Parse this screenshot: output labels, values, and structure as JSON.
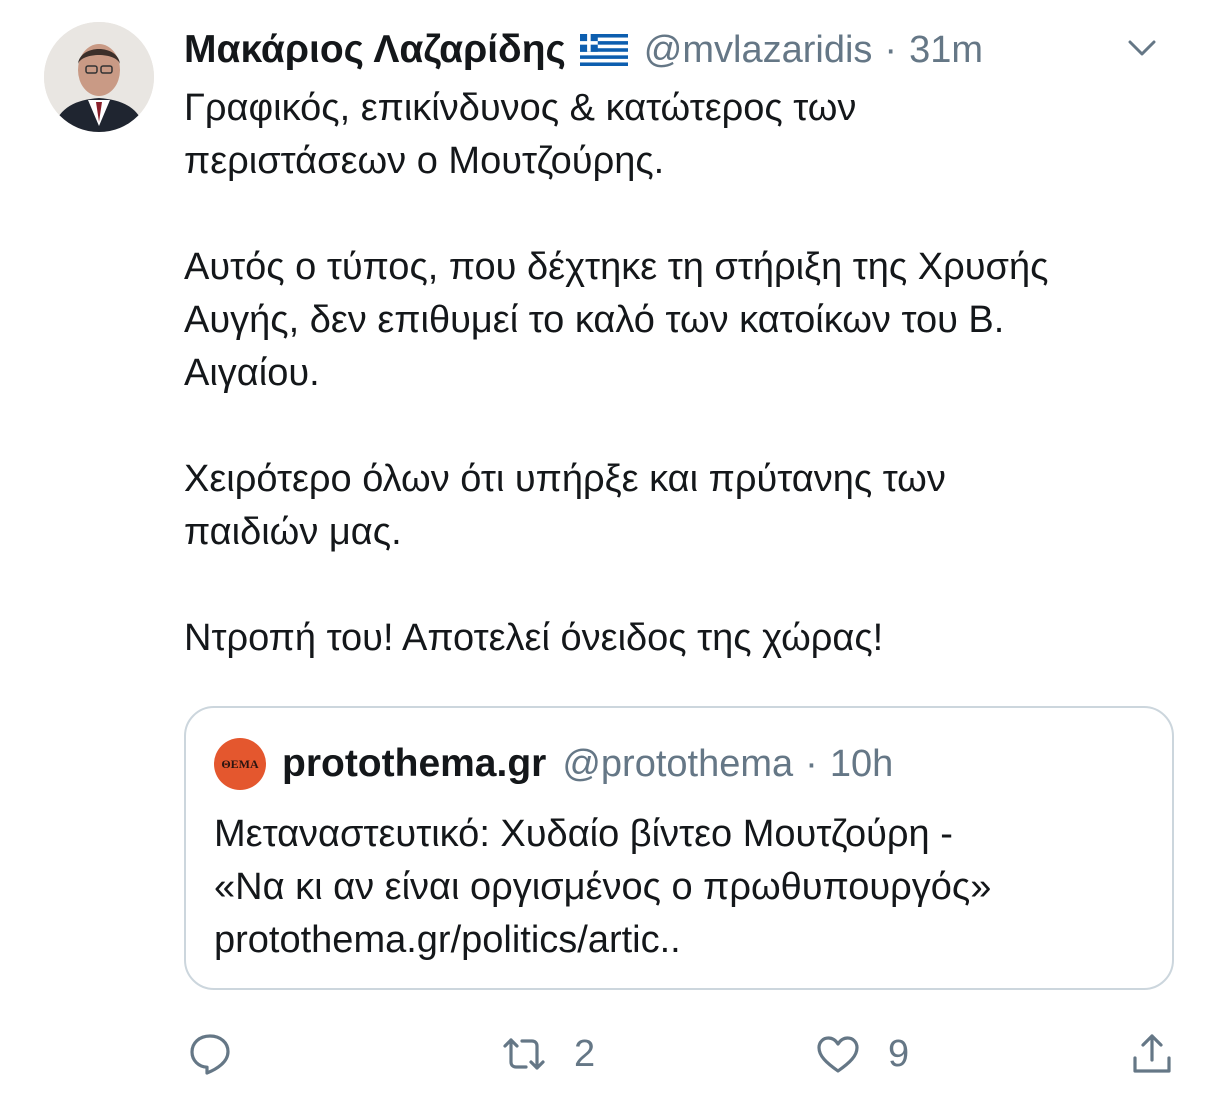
{
  "author": {
    "name": "Μακάριος Λαζαρίδης",
    "flag_icon": "greek-flag-icon",
    "handle": "@mvlazaridis",
    "separator": "·",
    "time": "31m"
  },
  "tweet": {
    "paragraphs": [
      [
        "Γραφικός, επικίνδυνος & κατώτερος των",
        "περιστάσεων ο Μουτζούρης."
      ],
      [
        "Αυτός ο τύπος, που δέχτηκε τη στήριξη της Χρυσής",
        "Αυγής, δεν επιθυμεί το καλό των κατοίκων του Β.",
        "Αιγαίου."
      ],
      [
        "Χειρότερο όλων ότι υπήρξε και πρύτανης των",
        "παιδιών μας."
      ],
      [
        "Ντροπή του! Αποτελεί όνειδος της χώρας!"
      ]
    ]
  },
  "quote": {
    "logo_text": "ΘΕΜΑ",
    "name": "protothema.gr",
    "handle": "@protothema",
    "separator": "·",
    "time": "10h",
    "lines": [
      "Μεταναστευτικό: Χυδαίο βίντεο Μουτζούρη -",
      "«Να κι αν είναι οργισμένος ο πρωθυπουργός»",
      "protothema.gr/politics/artic.."
    ]
  },
  "actions": {
    "reply_icon": "reply-icon",
    "retweet_icon": "retweet-icon",
    "retweet_count": "2",
    "like_icon": "heart-icon",
    "like_count": "9",
    "share_icon": "share-icon"
  },
  "colors": {
    "text_primary": "#14171a",
    "text_secondary": "#657786",
    "border": "#ccd6dd",
    "flag_blue": "#0d5eaf",
    "logo_orange": "#e4572e"
  }
}
